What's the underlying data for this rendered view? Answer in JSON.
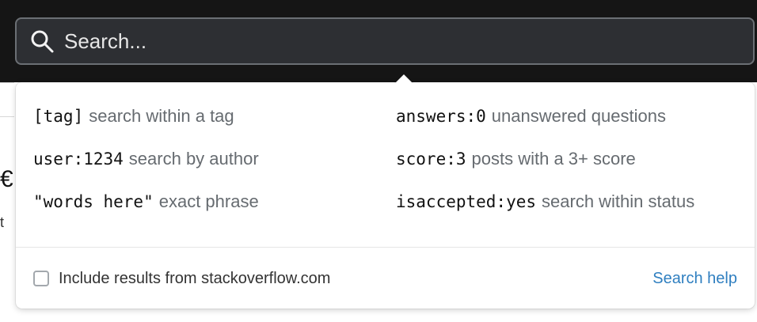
{
  "search": {
    "placeholder": "Search..."
  },
  "popup": {
    "hints": {
      "left": [
        {
          "code": "[tag]",
          "desc": "search within a tag"
        },
        {
          "code": "user:1234",
          "desc": "search by author"
        },
        {
          "code": "\"words here\"",
          "desc": "exact phrase"
        }
      ],
      "right": [
        {
          "code": "answers:0",
          "desc": "unanswered questions"
        },
        {
          "code": "score:3",
          "desc": "posts with a 3+ score"
        },
        {
          "code": "isaccepted:yes",
          "desc": "search within status"
        }
      ]
    },
    "footer": {
      "checkbox_label": "Include results from stackoverflow.com",
      "help_link": "Search help"
    }
  },
  "background": {
    "peek_text_1": "€",
    "peek_text_2": "t"
  },
  "colors": {
    "topbar_bg": "#151515",
    "search_bg": "#2d2f33",
    "link_blue": "#2f7fc0",
    "muted_text": "#666b70"
  },
  "icons": {
    "search": "magnifying-glass"
  }
}
